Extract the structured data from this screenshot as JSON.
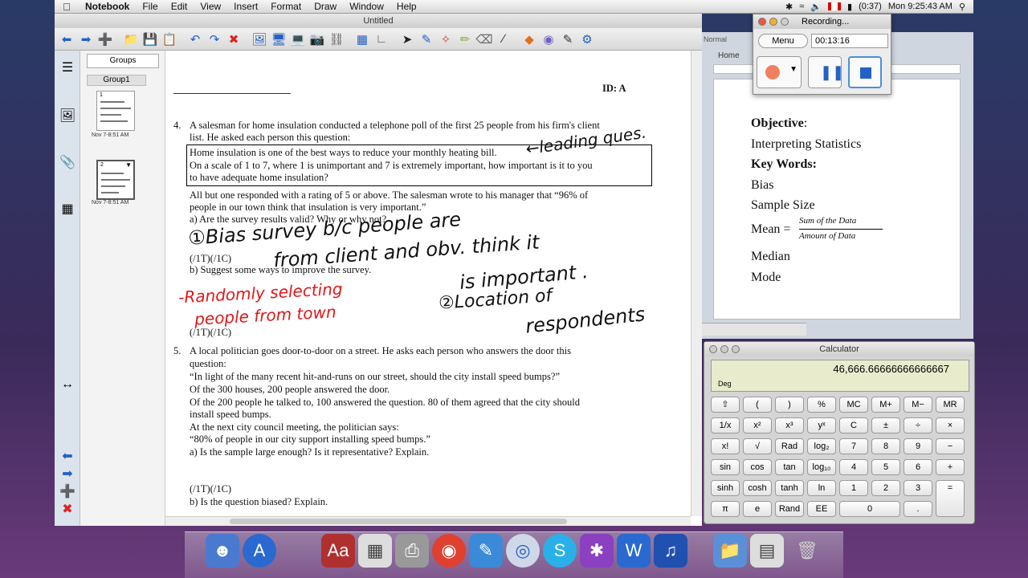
{
  "menubar": {
    "app": "Notebook",
    "items": [
      "File",
      "Edit",
      "View",
      "Insert",
      "Format",
      "Draw",
      "Window",
      "Help"
    ],
    "battery": "(0:37)",
    "clock": "Mon 9:25:43 AM"
  },
  "notebook": {
    "title": "Untitled",
    "groups_label": "Groups",
    "group_name": "Group1",
    "thumbs": [
      {
        "num": "1",
        "date": "Nov 7-8:51 AM"
      },
      {
        "num": "2",
        "date": "Nov 7-8:51 AM"
      }
    ],
    "page": {
      "id_label": "ID: A",
      "q4": {
        "number": "4.",
        "lines": [
          "A salesman for home insulation conducted a telephone poll of the first 25 people from his firm's client",
          "list. He asked each person this question:"
        ],
        "box_lines": [
          "Home insulation is one of the best ways to reduce your monthly heating bill.",
          "On a scale of 1 to 7, where 1 is unimportant and 7 is extremely important, how important is it to you",
          "to have adequate home insulation?"
        ],
        "after_lines": [
          "All but one responded with a rating of 5 or above. The salesman wrote to his manager that “96% of",
          "people in our town think that insulation is very important.”"
        ],
        "part_a": "a)   Are the survey results valid? Why or why not?",
        "score_a": "(/1T)(/1C)",
        "part_b": "b)   Suggest some ways to improve the survey.",
        "score_b": "(/1T)(/1C)"
      },
      "q5": {
        "number": "5.",
        "lines": [
          "A local politician goes door-to-door on a street. He asks each person who answers the door this",
          "question:",
          "“In light of the many recent hit-and-runs on our street, should the city install speed bumps?”",
          "Of the 300 houses, 200 people answered the door.",
          "Of the 200 people he talked to, 100 answered the question. 80 of them agreed that the city should",
          "install speed bumps.",
          "At the next city council meeting, the politician says:",
          "“80% of people in our city support installing speed bumps.”"
        ],
        "part_a": "a)   Is the sample large enough? Is it representative? Explain.",
        "score_a": "(/1T)(/1C)",
        "part_b": "b)   Is the question biased? Explain."
      },
      "ink": {
        "leading": "←leading ques.",
        "bias1": "①Bias   survey  b/c  people are",
        "bias2": "from client  and obv. think it",
        "bias3": "is important .",
        "loc1": "②Location  of",
        "loc2": "respondents",
        "red1": "-Randomly selecting",
        "red2": "people from town"
      }
    }
  },
  "recording": {
    "title": "Recording...",
    "menu_label": "Menu",
    "elapsed": "00:13:16"
  },
  "word": {
    "style": "Normal",
    "tab": "Home",
    "lines": [
      {
        "text": "Objective:",
        "bold": "Objective"
      },
      {
        "text": "Interpreting Statistics"
      },
      {
        "text": "Key Words:",
        "bold": "Key Words:"
      },
      {
        "text": "Bias"
      },
      {
        "text": "Sample Size"
      },
      {
        "text": "Mean ="
      },
      {
        "text": "Median"
      },
      {
        "text": "Mode"
      }
    ],
    "mean_num": "Sum of the Data",
    "mean_den": "Amount of Data"
  },
  "calculator": {
    "title": "Calculator",
    "display": "46,666.66666666666667",
    "mode": "Deg",
    "keys": [
      [
        "⇧",
        "(",
        ")",
        "%",
        "MC",
        "M+",
        "M−",
        "MR"
      ],
      [
        "1/x",
        "x²",
        "x³",
        "yˣ",
        "C",
        "±",
        "÷",
        "×"
      ],
      [
        "x!",
        "√",
        "Rad",
        "log₂",
        "7",
        "8",
        "9",
        "−"
      ],
      [
        "sin",
        "cos",
        "tan",
        "log₁₀",
        "4",
        "5",
        "6",
        "+"
      ],
      [
        "sinh",
        "cosh",
        "tanh",
        "ln",
        "1",
        "2",
        "3",
        ""
      ],
      [
        "π",
        "e",
        "Rand",
        "EE",
        "0",
        "",
        ".",
        "="
      ]
    ]
  },
  "colors": {
    "ink_black": "#111111",
    "ink_red": "#e01818",
    "accent_blue": "#2461c4"
  }
}
